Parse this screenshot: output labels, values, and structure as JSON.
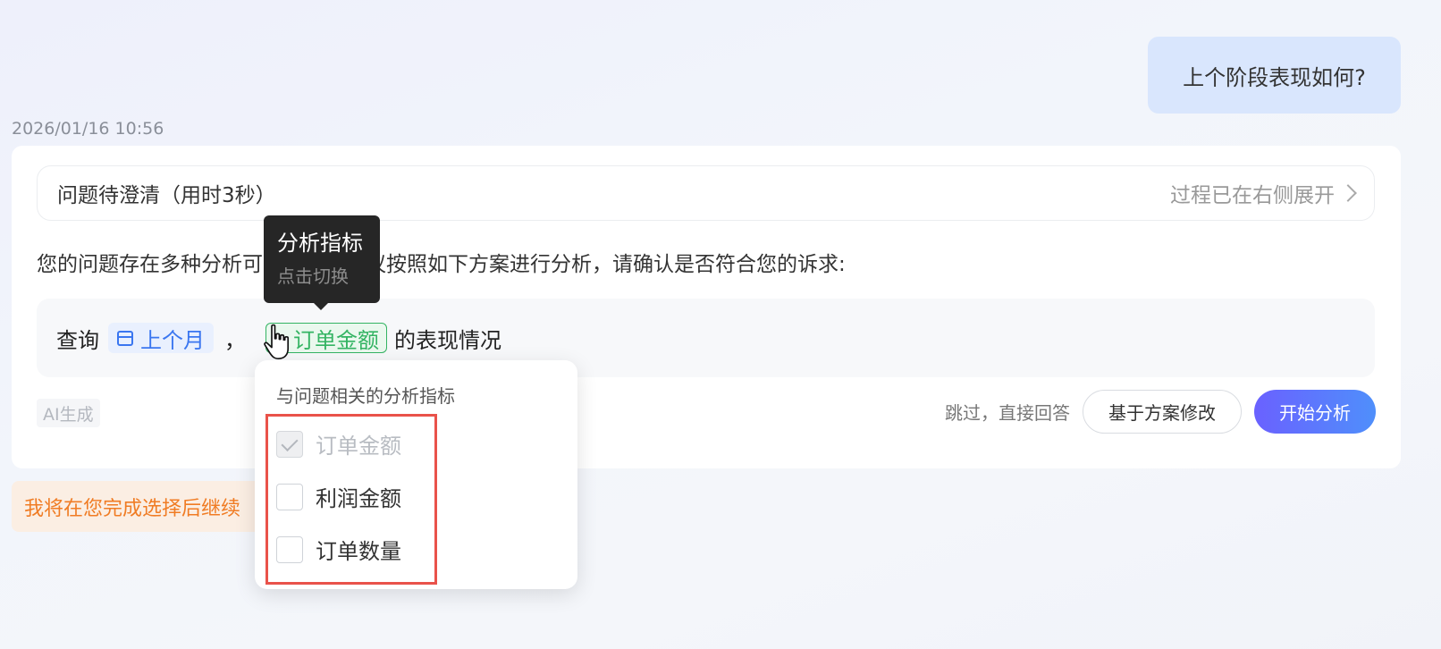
{
  "user_message": "上个阶段表现如何?",
  "timestamp": "2026/01/16 10:56",
  "clarify": {
    "status_title": "问题待澄清（用时3秒）",
    "status_link": "过程已在右侧展开",
    "intro_text": "您的问题存在多种分析可能性，我建议按照如下方案进行分析，请确认是否符合您的诉求:",
    "query": {
      "prefix": "查询",
      "date_chip": "上个月",
      "separator": "，",
      "metric_chip": "订单金额",
      "suffix": "的表现情况"
    },
    "ai_badge": "AI生成",
    "skip_label": "跳过，直接回答",
    "modify_label": "基于方案修改",
    "start_label": "开始分析"
  },
  "notice_text": "我将在您完成选择后继续",
  "tooltip": {
    "title": "分析指标",
    "subtitle": "点击切换"
  },
  "dropdown": {
    "title": "与问题相关的分析指标",
    "options": [
      {
        "label": "订单金额",
        "checked": true,
        "disabled": true
      },
      {
        "label": "利润金额",
        "checked": false,
        "disabled": false
      },
      {
        "label": "订单数量",
        "checked": false,
        "disabled": false
      }
    ]
  },
  "colors": {
    "accent_blue": "#3a76f0",
    "accent_green": "#34b463",
    "notice_orange": "#f07c24",
    "highlight_red": "#e9524a"
  }
}
